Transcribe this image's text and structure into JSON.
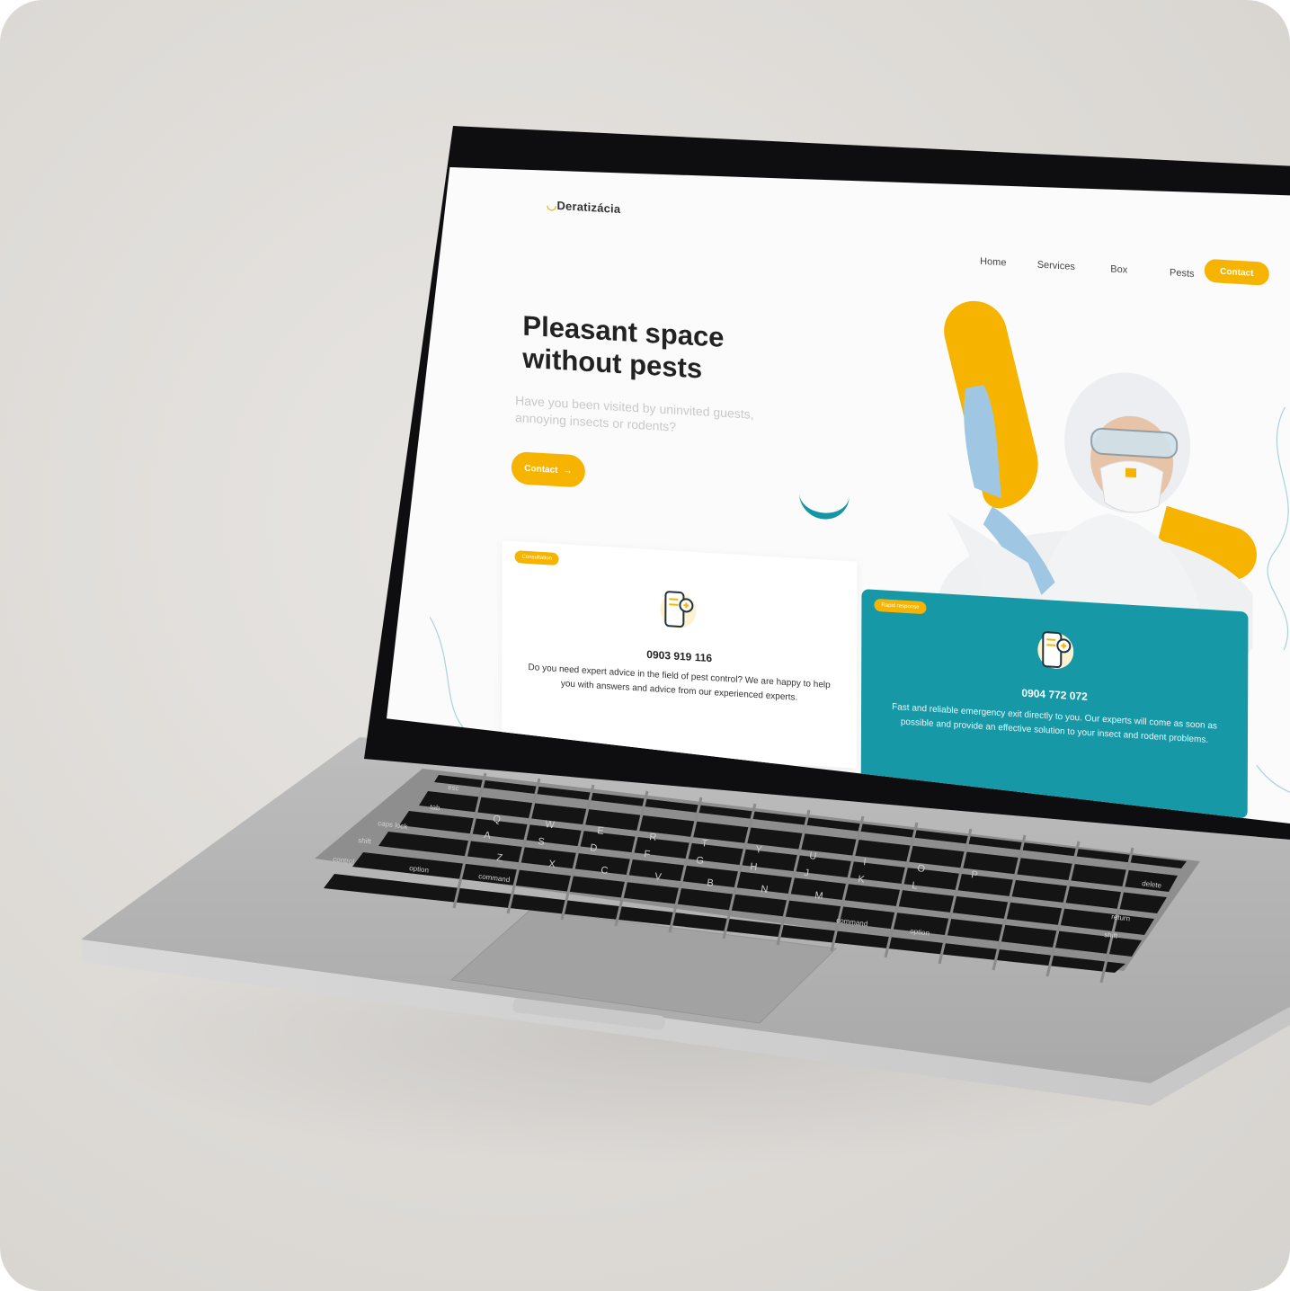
{
  "site": {
    "logo": "Deratizácia",
    "nav": [
      "Home",
      "Services",
      "Box",
      "Pests"
    ],
    "nav_contact": "Contact",
    "hero_title_line1": "Pleasant space",
    "hero_title_line2": "without pests",
    "hero_subtitle": "Have you been visited by uninvited guests, annoying insects or rodents?",
    "hero_button": "Contact",
    "card_consult": {
      "badge": "Consultation",
      "phone": "0903 919 116",
      "text": "Do you need expert advice in the field of pest control? We are happy to help you with answers and advice from our experienced experts."
    },
    "card_emergency": {
      "badge": "Rapid response",
      "phone": "0904 772 072",
      "text": "Fast and reliable emergency exit directly to you. Our experts will come as soon as possible and provide an effective solution to your insect and rodent problems."
    }
  },
  "keyboard": {
    "labels": [
      "esc",
      "tab",
      "caps lock",
      "shift",
      "control",
      "option",
      "command",
      "command",
      "option",
      "return",
      "shift",
      "delete",
      "Q",
      "W",
      "E",
      "R",
      "T",
      "Y",
      "U",
      "I",
      "O",
      "P",
      "A",
      "S",
      "D",
      "F",
      "G",
      "H",
      "J",
      "K",
      "L",
      "Z",
      "X",
      "C",
      "V",
      "B",
      "N",
      "M"
    ]
  },
  "colors": {
    "accent_yellow": "#f6b400",
    "accent_teal": "#1698a6",
    "lid": "#0e0e10",
    "aluminum": "#b9b9b9"
  }
}
